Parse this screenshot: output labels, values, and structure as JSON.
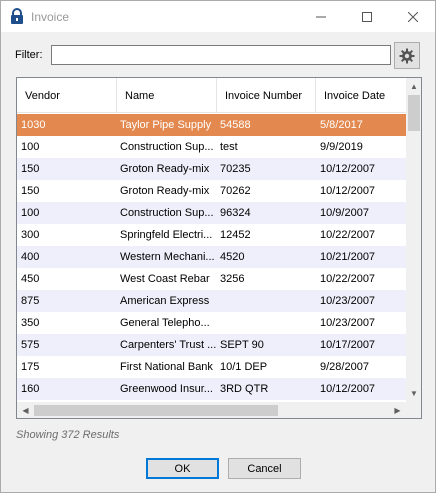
{
  "window": {
    "title": "Invoice",
    "controls": {
      "minimize": "—",
      "maximize": "☐",
      "close": "✕"
    }
  },
  "filter": {
    "label": "Filter:",
    "value": "",
    "settings_icon": "gear-icon"
  },
  "table": {
    "columns": [
      "Vendor",
      "Name",
      "Invoice Number",
      "Invoice Date"
    ],
    "rows": [
      [
        "1030",
        "Taylor Pipe Supply",
        "54588",
        "5/8/2017"
      ],
      [
        "100",
        "Construction Sup...",
        "test",
        "9/9/2019"
      ],
      [
        "150",
        "Groton Ready-mix",
        "70235",
        "10/12/2007"
      ],
      [
        "150",
        "Groton Ready-mix",
        "70262",
        "10/12/2007"
      ],
      [
        "100",
        "Construction Sup...",
        "96324",
        "10/9/2007"
      ],
      [
        "300",
        "Springfeld Electri...",
        "12452",
        "10/22/2007"
      ],
      [
        "400",
        "Western Mechani...",
        "4520",
        "10/21/2007"
      ],
      [
        "450",
        "West Coast Rebar",
        "3256",
        "10/22/2007"
      ],
      [
        "875",
        "American Express",
        "",
        "10/23/2007"
      ],
      [
        "350",
        "General Telepho...",
        "",
        "10/23/2007"
      ],
      [
        "575",
        "Carpenters' Trust ...",
        "SEPT 90",
        "10/17/2007"
      ],
      [
        "175",
        "First National Bank",
        "10/1 DEP",
        "9/28/2007"
      ],
      [
        "160",
        "Greenwood Insur...",
        "3RD QTR",
        "10/12/2007"
      ]
    ],
    "selected_row": 0
  },
  "status": {
    "text": "Showing 372 Results"
  },
  "buttons": {
    "ok": "OK",
    "cancel": "Cancel"
  },
  "colors": {
    "selected_row": "#e3894f",
    "alt_row": "#efeffb",
    "ok_border": "#0078d7"
  }
}
